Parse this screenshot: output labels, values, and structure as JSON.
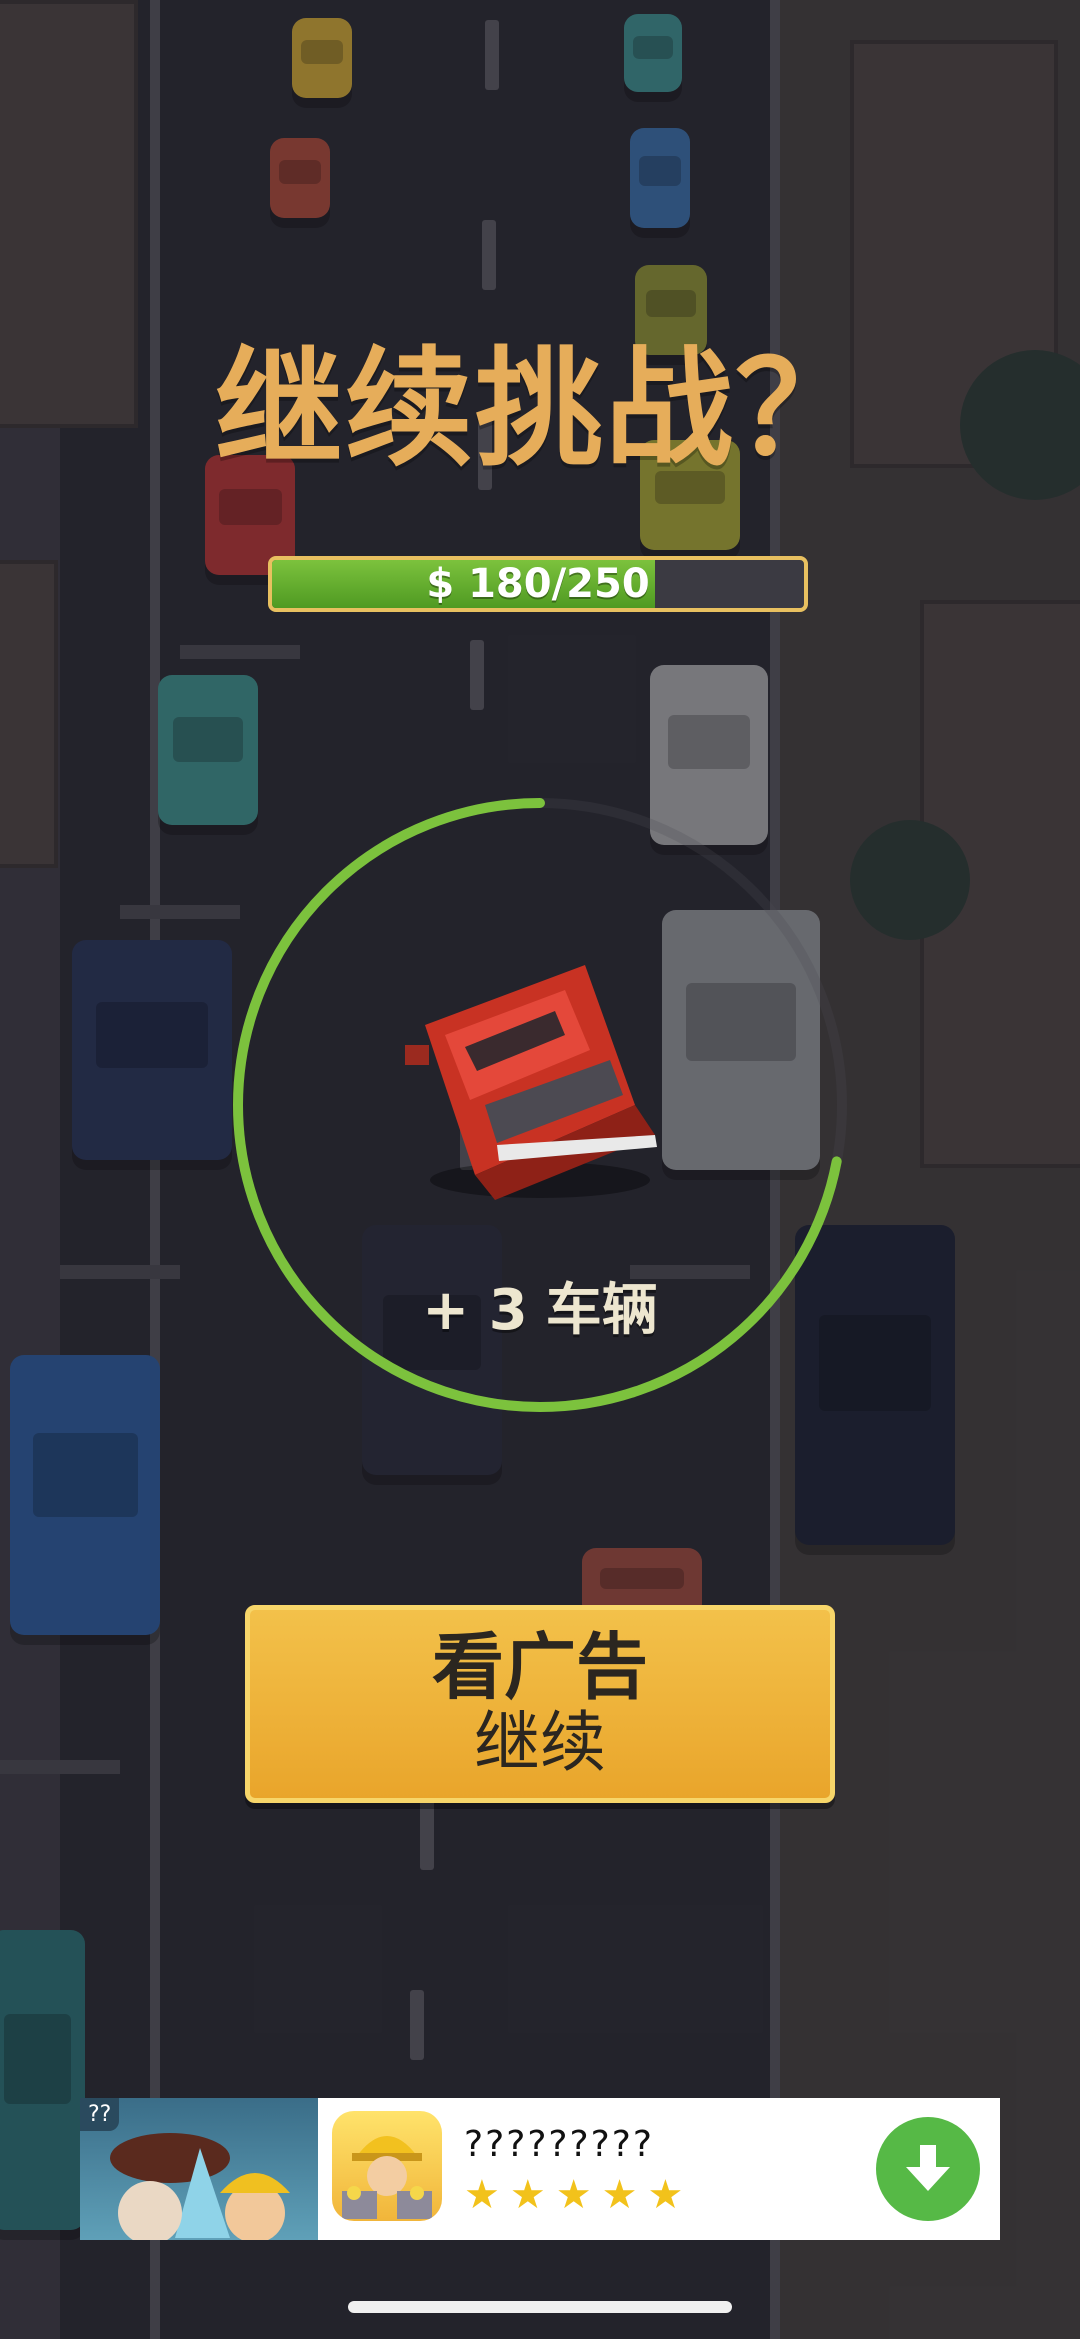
{
  "game": {
    "title": "继续挑战？",
    "progress": {
      "label": "$ 180/250",
      "current": 180,
      "goal": 250,
      "fraction": 0.72
    },
    "timer_ring_fraction": 0.72,
    "bonus": {
      "plus": "+ 3",
      "unit": "车辆"
    },
    "cta": {
      "line1": "看广告",
      "line2": "继续"
    }
  },
  "ad": {
    "tag": "??",
    "app_title": "?????????",
    "stars": [
      "★",
      "★",
      "★",
      "★",
      "★"
    ],
    "download_icon": "download-arrow-icon"
  },
  "colors": {
    "title": "#e6ad5a",
    "progress_fill": "#5ea92b",
    "ring": "#7cc23d",
    "cta_bg": "#f0b33c",
    "ad_download": "#56b946"
  }
}
